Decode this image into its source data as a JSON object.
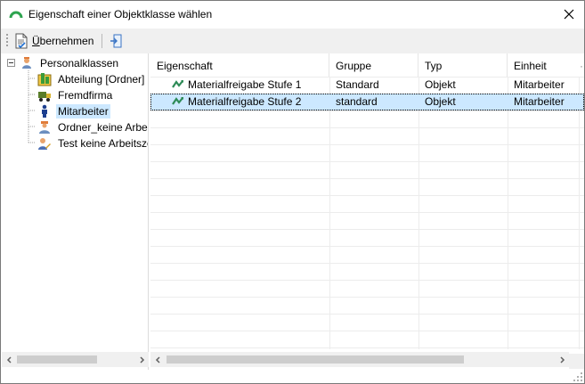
{
  "window": {
    "title": "Eigenschaft einer Objektklasse wählen"
  },
  "toolbar": {
    "apply_label_prefix": "",
    "apply_label_underlined": "Ü",
    "apply_label_rest": "bernehmen"
  },
  "tree": {
    "root": {
      "label": "Personalklassen",
      "icon": "people-group-icon"
    },
    "items": [
      {
        "label": "Abteilung [Ordner]",
        "icon": "department-folder-icon",
        "selected": false
      },
      {
        "label": "Fremdfirma",
        "icon": "truck-icon",
        "selected": false
      },
      {
        "label": "Mitarbeiter",
        "icon": "person-icon",
        "selected": true
      },
      {
        "label": "Ordner_keine Arbeit",
        "icon": "worker-icon",
        "selected": false
      },
      {
        "label": "Test keine Arbeitsze",
        "icon": "user-pencil-icon",
        "selected": false
      }
    ]
  },
  "grid": {
    "columns": [
      "Eigenschaft",
      "Gruppe",
      "Typ",
      "Einheit"
    ],
    "rows": [
      {
        "eigenschaft": "Materialfreigabe Stufe 1",
        "gruppe": "Standard",
        "typ": "Objekt",
        "einheit": "Mitarbeiter",
        "selected": false
      },
      {
        "eigenschaft": "Materialfreigabe Stufe 2",
        "gruppe": "standard",
        "typ": "Objekt",
        "einheit": "Mitarbeiter",
        "selected": true
      }
    ]
  },
  "colors": {
    "selection": "#cce8ff",
    "toolbar_bg": "#f0f0f0",
    "title_icon": "#2ea44f",
    "property_icon": "#2e8b57"
  }
}
